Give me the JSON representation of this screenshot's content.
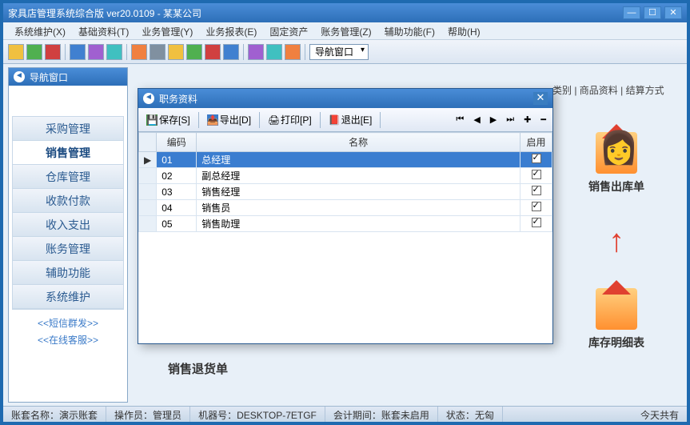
{
  "window": {
    "title": "家具店管理系统综合版 ver20.0109 - 某某公司"
  },
  "menus": [
    "系统维护(X)",
    "基础资料(T)",
    "业务管理(Y)",
    "业务报表(E)",
    "固定资产",
    "账务管理(Z)",
    "辅助功能(F)",
    "帮助(H)"
  ],
  "toolbar_dropdown": "导航窗口",
  "nav": {
    "title": "导航窗口",
    "items": [
      "采购管理",
      "销售管理",
      "仓库管理",
      "收款付款",
      "收入支出",
      "账务管理",
      "辅助功能",
      "系统维护"
    ],
    "active_index": 1,
    "links": [
      "<<短信群发>>",
      "<<在线客服>>"
    ]
  },
  "right": {
    "tabs": "类别 | 商品资料 | 结算方式",
    "shortcuts": [
      {
        "label": "销售出库单"
      },
      {
        "label": ""
      },
      {
        "label": "库存明细表"
      }
    ]
  },
  "center_label": "销售退货单",
  "modal": {
    "title": "职务资料",
    "buttons": {
      "save": "保存[S]",
      "export": "导出[D]",
      "print": "打印[P]",
      "exit": "退出[E]"
    },
    "columns": {
      "code": "编码",
      "name": "名称",
      "enable": "启用"
    },
    "rows": [
      {
        "code": "01",
        "name": "总经理",
        "enable": true,
        "selected": true
      },
      {
        "code": "02",
        "name": "副总经理",
        "enable": true
      },
      {
        "code": "03",
        "name": "销售经理",
        "enable": true
      },
      {
        "code": "04",
        "name": "销售员",
        "enable": true
      },
      {
        "code": "05",
        "name": "销售助理",
        "enable": true
      }
    ]
  },
  "status": {
    "s1_label": "账套名称：",
    "s1_val": "演示账套",
    "s2_label": "操作员：",
    "s2_val": "管理员",
    "s3_label": "机器号：",
    "s3_val": "DESKTOP-7ETGF",
    "s4_label": "会计期间：",
    "s4_val": "账套未启用",
    "s5_label": "状态：",
    "s5_val": "无匈",
    "s6": "今天共有"
  }
}
